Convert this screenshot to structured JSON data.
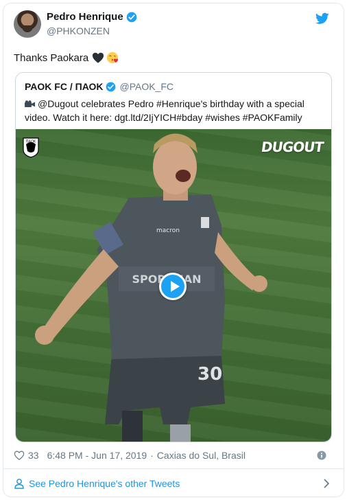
{
  "header": {
    "display_name": "Pedro Henrique",
    "handle": "@PHKONZEN"
  },
  "tweet": {
    "text": "Thanks Paokara"
  },
  "quote": {
    "display_name": "PAOK FC / ΠΑΟΚ",
    "handle": "@PAOK_FC",
    "text": "@Dugout celebrates Pedro #Henrique's birthday with a special video. Watch it here: dgt.ltd/2IjYICH#bday #wishes #PAOKFamily",
    "video_watermark": "DUGOUT"
  },
  "meta": {
    "likes": "33",
    "time": "6:48 PM - Jun 17, 2019",
    "location": "Caxias do Sul, Brasil"
  },
  "footer": {
    "link_text": "See Pedro Henrique's other Tweets"
  },
  "icons": {
    "brand": "twitter-bird-icon",
    "verified": "verified-badge-icon",
    "like": "heart-outline-icon",
    "info": "info-icon",
    "person": "person-outline-icon",
    "chevron": "chevron-right-icon",
    "play": "play-icon"
  },
  "colors": {
    "twitter_blue": "#1da1f2",
    "link_blue": "#1b95e0",
    "text": "#14171a",
    "muted": "#657786",
    "border": "#e1e8ed"
  }
}
